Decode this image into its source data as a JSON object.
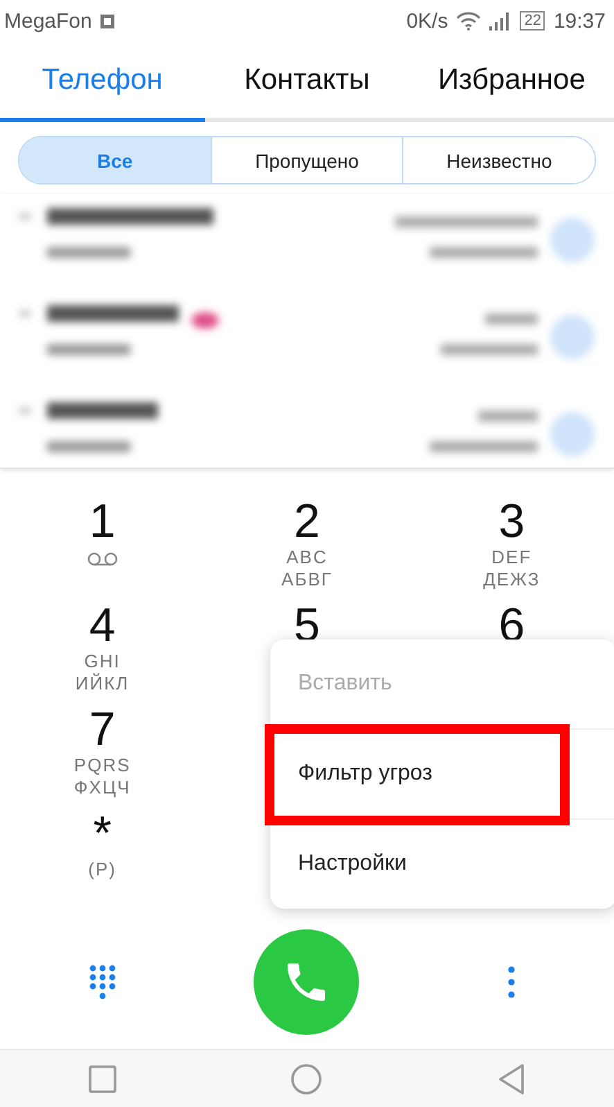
{
  "status_bar": {
    "carrier": "MegaFon",
    "speed": "0K/s",
    "battery": "22",
    "time": "19:37"
  },
  "tabs": [
    {
      "label": "Телефон",
      "selected": true
    },
    {
      "label": "Контакты",
      "selected": false
    },
    {
      "label": "Избранное",
      "selected": false
    }
  ],
  "filters": [
    {
      "label": "Все",
      "selected": true
    },
    {
      "label": "Пропущено",
      "selected": false
    },
    {
      "label": "Неизвестно",
      "selected": false
    }
  ],
  "keypad": [
    {
      "digit": "1",
      "kind": "voicemail"
    },
    {
      "digit": "2",
      "letters": [
        "ABC",
        "АБВГ"
      ],
      "kind": "letters"
    },
    {
      "digit": "3",
      "letters": [
        "DEF",
        "ДЕЖЗ"
      ],
      "kind": "letters"
    },
    {
      "digit": "4",
      "letters": [
        "GHI",
        "ИЙКЛ"
      ],
      "kind": "letters"
    },
    {
      "digit": "5",
      "kind": "letters"
    },
    {
      "digit": "6",
      "kind": "letters"
    },
    {
      "digit": "7",
      "letters": [
        "PQRS",
        "ФХЦЧ"
      ],
      "kind": "letters"
    },
    {
      "digit": "*",
      "letters": [
        "(P)"
      ],
      "kind": "letters"
    }
  ],
  "menu": [
    {
      "label": "Вставить",
      "disabled": true,
      "highlighted": false
    },
    {
      "label": "Фильтр угроз",
      "disabled": false,
      "highlighted": true
    },
    {
      "label": "Настройки",
      "disabled": false,
      "highlighted": false
    }
  ]
}
